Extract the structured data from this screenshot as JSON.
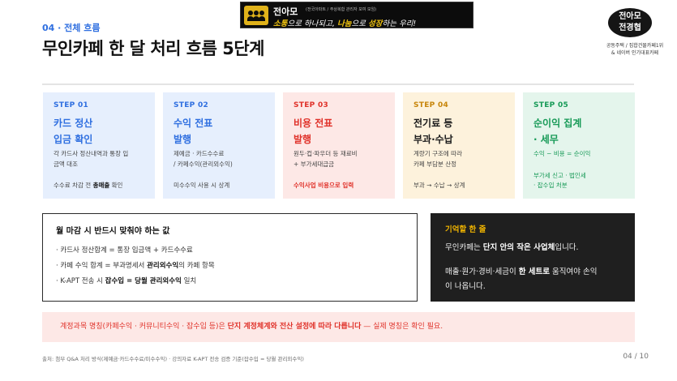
{
  "banner": {
    "name": "전아모",
    "sub": "(전국아파트 / 주상복합 관리자 모여 모임)",
    "slogan_1": "소통",
    "slogan_2": "으로 하나되고, ",
    "slogan_3": "나눔",
    "slogan_4": "으로 ",
    "slogan_5": "성장",
    "slogan_6": "하는 우리!"
  },
  "logo": {
    "line1": "전아모",
    "line2": "전경협",
    "tagline": "공동주택 / 집합건물카페1위\n& 네이버 인기대표카페"
  },
  "header": {
    "eyebrow": "04 · 전체 흐름",
    "title": "무인카페 한 달 처리 흐름 5단계"
  },
  "steps": [
    {
      "label": "STEP 01",
      "title": "카드 정산\n입금 확인",
      "desc": "각 카드사 정산내역과 통장 입\n금액 대조",
      "foot_pre": "수수료 차감 전 ",
      "foot_bold": "총매출",
      "foot_post": " 확인"
    },
    {
      "label": "STEP 02",
      "title": "수익 전표\n발행",
      "desc": "제예금 · 카드수수료\n/ 카페수익(관리외수익)",
      "foot": "미수수익 사용 시 상계"
    },
    {
      "label": "STEP 03",
      "title": "비용 전표\n발행",
      "desc": "원두·컵·파우더 등 재료비\n+ 부가세대급금",
      "foot": "수익사업 비용으로 입력"
    },
    {
      "label": "STEP 04",
      "title": "전기료 등\n부과·수납",
      "desc": "계량기 구조에 따라\n카페 부담분 산정",
      "foot": "부과 → 수납 → 상계"
    },
    {
      "label": "STEP 05",
      "title": "순이익 집계\n· 세무",
      "desc": "수익 − 비용 = 순이익",
      "foot": "부가세 신고 · 법인세\n· 잡수입 처분"
    }
  ],
  "checklist": {
    "title": "월 마감 시 반드시 맞춰야 하는 값",
    "item1": "· 카드사 정산합계 = 통장 입금액 + 카드수수료",
    "item2_pre": "· 카페 수익 합계 = 부과명세서 ",
    "item2_bold": "관리외수익",
    "item2_post": "의 카페 항목",
    "item3_pre": "· K-APT 전송 시 ",
    "item3_bold": "잡수입 = 당월 관리외수익",
    "item3_post": " 일치"
  },
  "memo": {
    "title": "기억할 한 줄",
    "line1_pre": "무인카페는 ",
    "line1_bold": "단지 안의 작은 사업체",
    "line1_post": "입니다.",
    "line2_pre": "매출·원가·경비·세금이 ",
    "line2_bold": "한 세트로",
    "line2_post": " 움직여야 손익",
    "line3": "이 나옵니다."
  },
  "note": {
    "pre": "계정과목 명칭(카페수익 · 커뮤니티수익 · 잡수입 등)은 ",
    "bold": "단지 계정체계와 전산 설정에 따라 다릅니다",
    "post": " — 실제 명칭은 확인 필요."
  },
  "footer": {
    "source": "출처: 첨부 Q&A 처리 방식(제예금·카드수수료/미수수익) · 강의자료 K-APT 전송 검증 기준(잡수입 = 당월 관리외수익)",
    "page": "04 / 10"
  },
  "colors": {
    "blue": "#2f6fe0",
    "red": "#e0322a",
    "amber": "#c7850a",
    "green": "#179a57",
    "memo_bg": "#1f1f1f",
    "memo_accent": "#f0b400"
  }
}
